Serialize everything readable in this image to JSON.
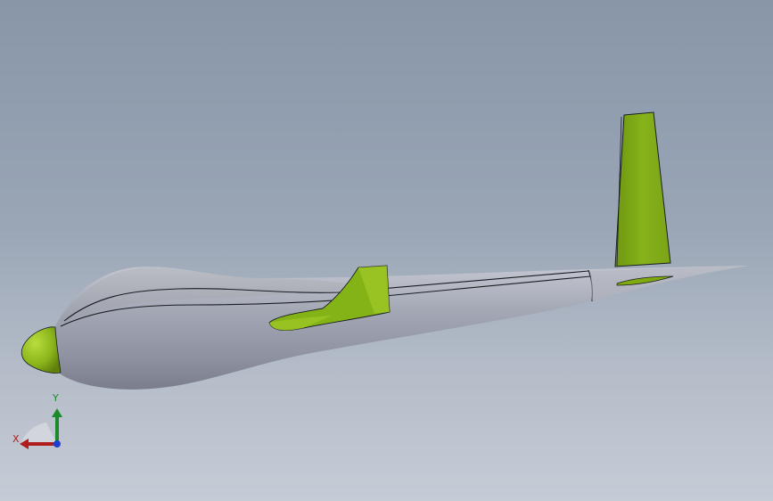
{
  "viewport": {
    "background_top": "#8896a8",
    "background_bottom": "#c6ccd6"
  },
  "model": {
    "body_color": "#9a9eab",
    "feature_color": "#7faa0f",
    "edge_color": "#1a1d22"
  },
  "triad": {
    "x_label": "X",
    "y_label": "Y",
    "x_color": "#b11c1c",
    "y_color": "#1c8a2a",
    "z_color": "#1d3fd1"
  }
}
